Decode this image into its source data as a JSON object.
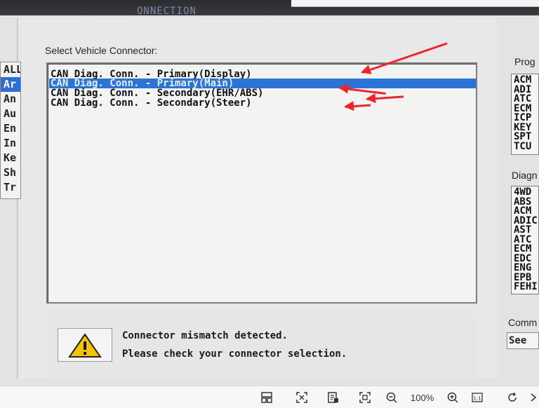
{
  "window": {
    "title_fragment": "ONNECTION"
  },
  "left_menu": [
    {
      "label": "ALL",
      "active": false
    },
    {
      "label": "Ar",
      "active": true
    },
    {
      "label": "An",
      "active": false
    },
    {
      "label": "Au",
      "active": false
    },
    {
      "label": "En",
      "active": false
    },
    {
      "label": "In",
      "active": false
    },
    {
      "label": "Ke",
      "active": false
    },
    {
      "label": "Sh",
      "active": false
    },
    {
      "label": "Tr",
      "active": false
    }
  ],
  "connector": {
    "label": "Select Vehicle Connector:",
    "items": [
      {
        "label": "CAN Diag. Conn. - Primary(Display)",
        "selected": false
      },
      {
        "label": "CAN Diag. Conn. - Primary(Main)",
        "selected": true
      },
      {
        "label": "CAN Diag. Conn. - Secondary(EHR/ABS)",
        "selected": false
      },
      {
        "label": "CAN Diag. Conn. - Secondary(Steer)",
        "selected": false
      }
    ]
  },
  "message": {
    "line1": "Connector mismatch detected.",
    "line2": "Please check your connector selection."
  },
  "programs": {
    "label": "Prog",
    "items": [
      "ACM",
      "ADI",
      "ATC",
      "ECM",
      "ICP",
      "KEY",
      "SPT",
      "TCU"
    ]
  },
  "diagnostics": {
    "label": "Diagn",
    "items": [
      "4WD",
      "ABS",
      "ACM",
      "ADIC",
      "AST",
      "ATC",
      "ECM",
      "EDC",
      "ENG",
      "EPB",
      "FEHI"
    ]
  },
  "comments": {
    "label": "Comm",
    "value": "See"
  },
  "toolbar": {
    "zoom": "100%"
  },
  "colors": {
    "selection": "#2a74d8",
    "annotation_arrow": "#f0232b"
  }
}
